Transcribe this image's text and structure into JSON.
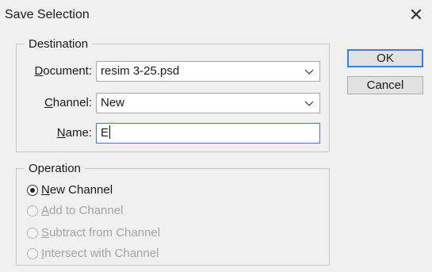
{
  "window": {
    "title": "Save Selection",
    "close_glyph": "✕"
  },
  "destination": {
    "legend": "Destination",
    "document": {
      "label_key": "D",
      "label_rest": "ocument:",
      "value": "resim 3-25.psd"
    },
    "channel": {
      "label_key": "C",
      "label_rest": "hannel:",
      "value": "New"
    },
    "name": {
      "label_key": "N",
      "label_rest": "ame:",
      "value": "E"
    }
  },
  "operation": {
    "legend": "Operation",
    "options": [
      {
        "key": "N",
        "rest": "ew Channel",
        "selected": true,
        "enabled": true
      },
      {
        "key": "A",
        "rest": "dd to Channel",
        "selected": false,
        "enabled": false
      },
      {
        "key": "S",
        "rest": "ubtract from Channel",
        "selected": false,
        "enabled": false
      },
      {
        "key": "I",
        "rest": "ntersect with Channel",
        "selected": false,
        "enabled": false
      }
    ]
  },
  "buttons": {
    "ok": "OK",
    "cancel": "Cancel"
  },
  "icons": {
    "dropdown": "chevron-down-icon",
    "close": "close-icon",
    "radio": "radio-icon"
  },
  "colors": {
    "focus_border": "#3a7bd5",
    "default_button_border": "#3c7fd8",
    "dialog_bg": "#f0f0f0"
  }
}
